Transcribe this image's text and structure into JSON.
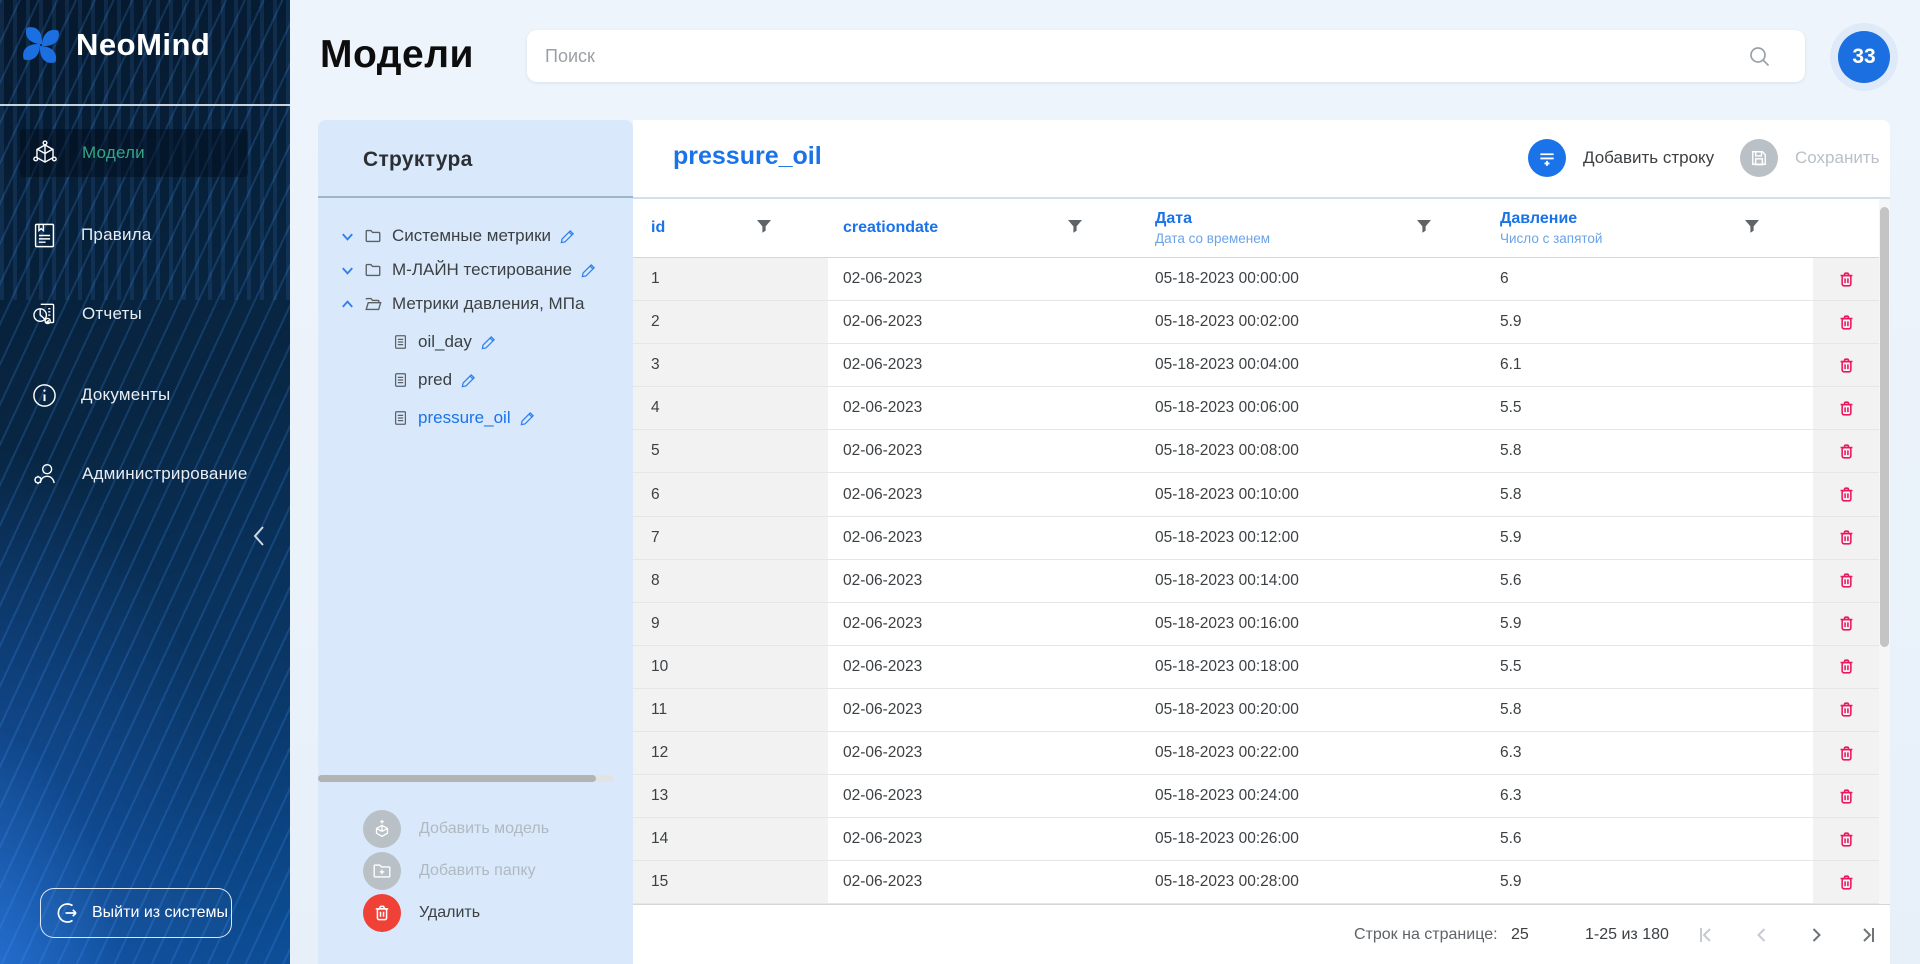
{
  "sidebar": {
    "logo": "NeoMind",
    "items": [
      {
        "label": "Модели",
        "icon": "model-cube-icon",
        "active": true
      },
      {
        "label": "Правила",
        "icon": "rules-document-icon",
        "active": false
      },
      {
        "label": "Отчеты",
        "icon": "report-chart-icon",
        "active": false
      },
      {
        "label": "Документы",
        "icon": "info-circle-icon",
        "active": false
      },
      {
        "label": "Администрирование",
        "icon": "admin-user-gear-icon",
        "active": false
      }
    ],
    "logout_label": "Выйти из системы"
  },
  "header": {
    "title": "Модели",
    "search_placeholder": "Поиск",
    "badge_count": "33"
  },
  "tree": {
    "title": "Структура",
    "items": [
      {
        "label": "Системные метрики",
        "type": "folder",
        "state": "collapsed"
      },
      {
        "label": "М-ЛАЙН тестирование",
        "type": "folder",
        "state": "collapsed"
      },
      {
        "label": "Метрики давления, МПа",
        "type": "folder-open",
        "state": "expanded"
      }
    ],
    "children": [
      {
        "label": "oil_day",
        "selected": false
      },
      {
        "label": "pred",
        "selected": false
      },
      {
        "label": "pressure_oil",
        "selected": true
      }
    ],
    "actions": [
      {
        "label": "Добавить модель",
        "disabled": true
      },
      {
        "label": "Добавить папку",
        "disabled": true
      },
      {
        "label": "Удалить",
        "disabled": false
      }
    ]
  },
  "table": {
    "title": "pressure_oil",
    "add_row_label": "Добавить строку",
    "save_label": "Сохранить",
    "columns": [
      {
        "name": "id",
        "subtitle": ""
      },
      {
        "name": "creationdate",
        "subtitle": ""
      },
      {
        "name": "Дата",
        "subtitle": "Дата со временем"
      },
      {
        "name": "Давление",
        "subtitle": "Число с запятой"
      }
    ],
    "rows": [
      [
        "1",
        "02-06-2023",
        "05-18-2023 00:00:00",
        "6"
      ],
      [
        "2",
        "02-06-2023",
        "05-18-2023 00:02:00",
        "5.9"
      ],
      [
        "3",
        "02-06-2023",
        "05-18-2023 00:04:00",
        "6.1"
      ],
      [
        "4",
        "02-06-2023",
        "05-18-2023 00:06:00",
        "5.5"
      ],
      [
        "5",
        "02-06-2023",
        "05-18-2023 00:08:00",
        "5.8"
      ],
      [
        "6",
        "02-06-2023",
        "05-18-2023 00:10:00",
        "5.8"
      ],
      [
        "7",
        "02-06-2023",
        "05-18-2023 00:12:00",
        "5.9"
      ],
      [
        "8",
        "02-06-2023",
        "05-18-2023 00:14:00",
        "5.6"
      ],
      [
        "9",
        "02-06-2023",
        "05-18-2023 00:16:00",
        "5.9"
      ],
      [
        "10",
        "02-06-2023",
        "05-18-2023 00:18:00",
        "5.5"
      ],
      [
        "11",
        "02-06-2023",
        "05-18-2023 00:20:00",
        "5.8"
      ],
      [
        "12",
        "02-06-2023",
        "05-18-2023 00:22:00",
        "6.3"
      ],
      [
        "13",
        "02-06-2023",
        "05-18-2023 00:24:00",
        "6.3"
      ],
      [
        "14",
        "02-06-2023",
        "05-18-2023 00:26:00",
        "5.6"
      ],
      [
        "15",
        "02-06-2023",
        "05-18-2023 00:28:00",
        "5.9"
      ]
    ],
    "footer": {
      "rows_per_page_label": "Строк на странице:",
      "rows_per_page": "25",
      "range_label": "1-25 из 180"
    }
  },
  "colors": {
    "accent_blue": "#1a73e8",
    "badge_blue": "#1b6fe0",
    "active_menu_green": "#34a585",
    "delete_circle_red": "#ef4136",
    "trash_pink": "#ea1860",
    "tree_panel_bg": "#d9e9fb",
    "sidebar_navy": "#082745"
  }
}
